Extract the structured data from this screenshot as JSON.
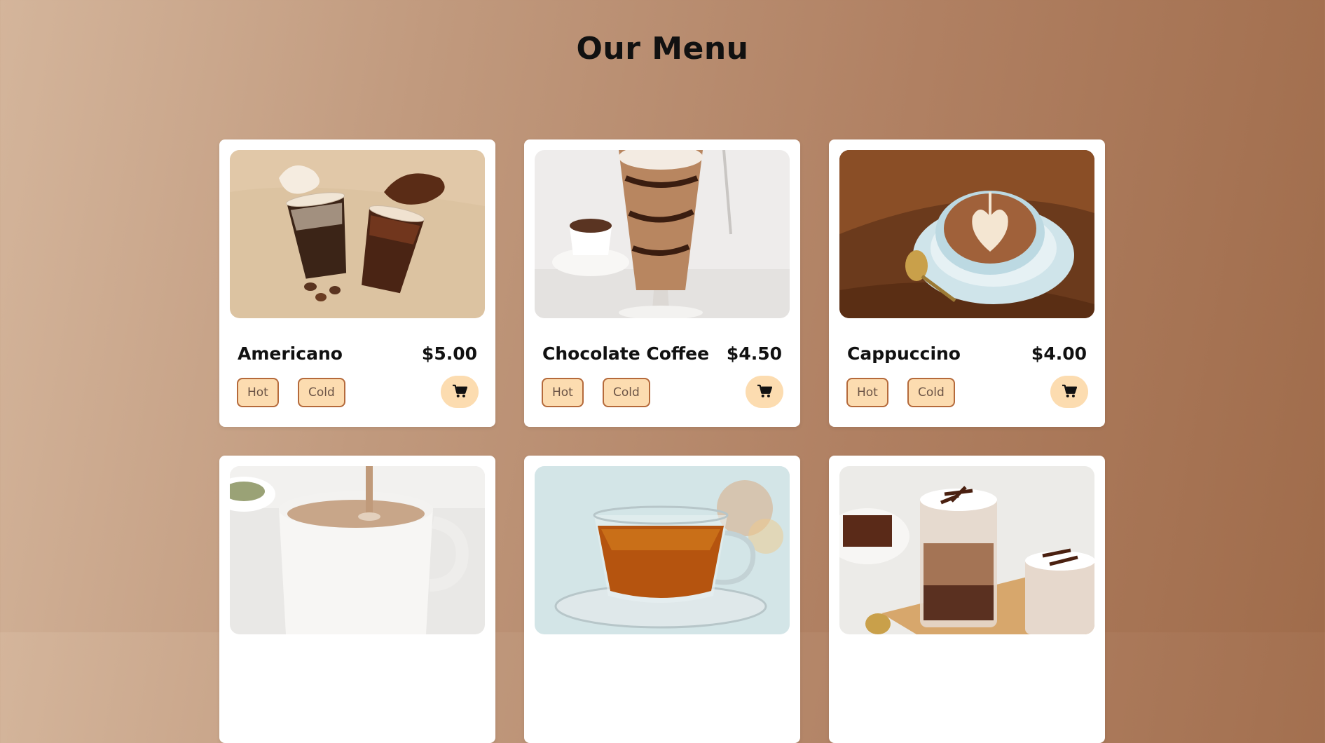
{
  "page": {
    "title": "Our Menu"
  },
  "tags": {
    "hot": "Hot",
    "cold": "Cold"
  },
  "icons": {
    "cart": "shopping-cart-icon"
  },
  "colors": {
    "tag_background": "#fcdcb0",
    "tag_border": "#b56a3b",
    "card_background": "#ffffff"
  },
  "menu": [
    {
      "name": "Americano",
      "price": "$5.00",
      "image": "iced-coffee-cups-photo"
    },
    {
      "name": "Chocolate Coffee",
      "price": "$4.50",
      "image": "chocolate-frappe-glass-photo"
    },
    {
      "name": "Cappuccino",
      "price": "$4.00",
      "image": "latte-art-cup-photo"
    },
    {
      "name": "",
      "price": "",
      "image": "milk-tea-mug-photo"
    },
    {
      "name": "",
      "price": "",
      "image": "black-tea-glass-cup-photo"
    },
    {
      "name": "",
      "price": "",
      "image": "hot-chocolate-mugs-photo"
    }
  ]
}
